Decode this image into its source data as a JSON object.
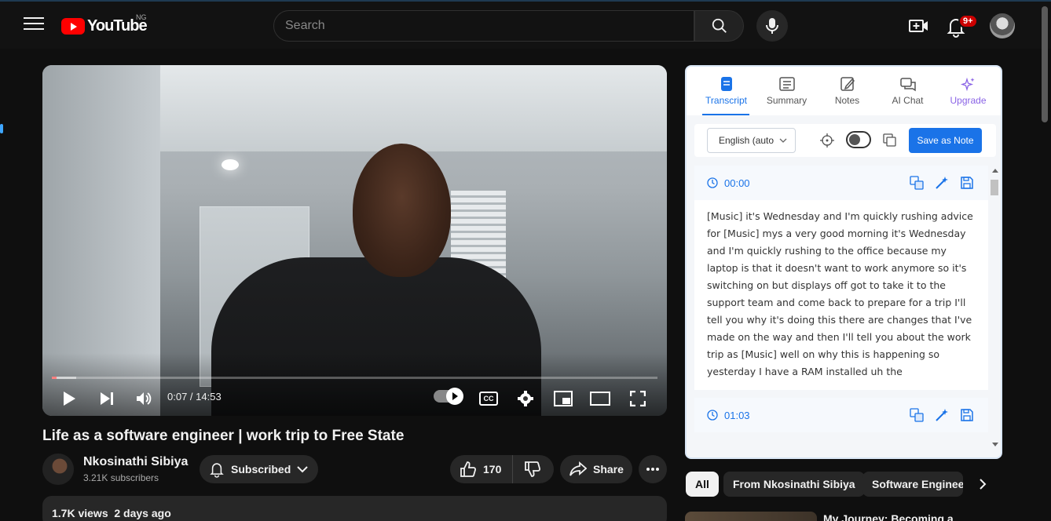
{
  "header": {
    "logo_text": "YouTube",
    "country_code": "NG",
    "search_placeholder": "Search",
    "notification_count": "9+"
  },
  "player": {
    "time": "0:07 / 14:53",
    "progress_fraction": 0.008
  },
  "video": {
    "title": "Life as a software engineer | work trip to Free State",
    "channel_name": "Nkosinathi Sibiya",
    "subscribers": "3.21K subscribers",
    "subscribed_label": "Subscribed",
    "likes": "170",
    "share_label": "Share",
    "description_meta": "1.7K views  2 days ago"
  },
  "transcript_panel": {
    "tabs": [
      {
        "label": "Transcript"
      },
      {
        "label": "Summary"
      },
      {
        "label": "Notes"
      },
      {
        "label": "AI Chat"
      },
      {
        "label": "Upgrade"
      }
    ],
    "language": "English (auto",
    "save_as_note": "Save as Note",
    "segments": [
      {
        "time": "00:00",
        "text": "[Music] it's Wednesday and I'm quickly rushing advice for [Music] mys a very good morning it's Wednesday and I'm quickly rushing to the office because my laptop is that it doesn't want to work anymore so it's switching on but displays off got to take it to the support team and come back to prepare for a trip I'll tell you why it's doing this there are changes that I've made on the way and then I'll tell you about the work trip as [Music] well on why this is happening so yesterday I have a RAM installed uh the"
      },
      {
        "time": "01:03",
        "text": ""
      }
    ]
  },
  "chips": [
    {
      "label": "All"
    },
    {
      "label": "From Nkosinathi Sibiya"
    },
    {
      "label": "Software Engineer"
    }
  ],
  "recommendation": {
    "title": "My Journey: Becoming a"
  }
}
